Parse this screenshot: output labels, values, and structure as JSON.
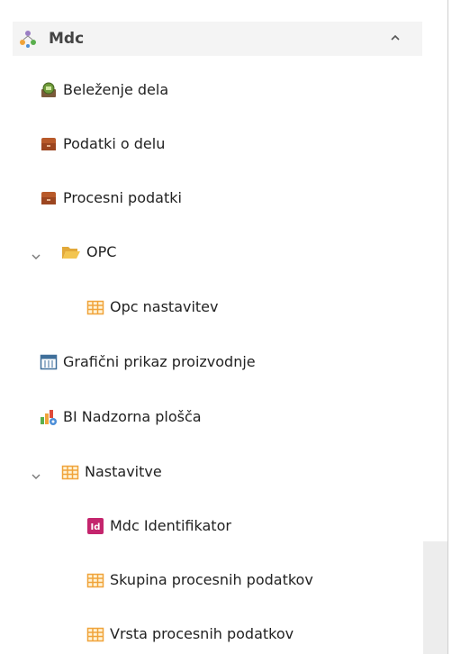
{
  "group": {
    "title": "Mdc",
    "icon": "people-network-icon",
    "toggle_icon": "chevron-up-icon"
  },
  "items": [
    {
      "label": "Beleženje dela",
      "icon": "time-clock-icon"
    },
    {
      "label": "Podatki o delu",
      "icon": "folder-brown-icon"
    },
    {
      "label": "Procesni podatki",
      "icon": "folder-brown-icon"
    },
    {
      "label": "OPC",
      "icon": "open-folder-icon",
      "expanded": true
    },
    {
      "label": "Opc nastavitev",
      "icon": "grid-table-icon"
    },
    {
      "label": "Grafični prikaz proizvodnje",
      "icon": "calendar-grid-icon"
    },
    {
      "label": "BI Nadzorna plošča",
      "icon": "bar-chart-gear-icon"
    },
    {
      "label": "Nastavitve",
      "icon": "grid-table-icon",
      "expanded": true
    },
    {
      "label": "Mdc Identifikator",
      "icon": "id-badge-icon"
    },
    {
      "label": "Skupina procesnih podatkov",
      "icon": "grid-table-icon"
    },
    {
      "label": "Vrsta procesnih podatkov",
      "icon": "grid-table-icon"
    }
  ],
  "colors": {
    "grid_orange": "#f0a33a",
    "folder_brown": "#b85a2a",
    "folder_yellow": "#f3c550",
    "id_magenta": "#c4256d",
    "header_bg": "#f4f4f4"
  }
}
